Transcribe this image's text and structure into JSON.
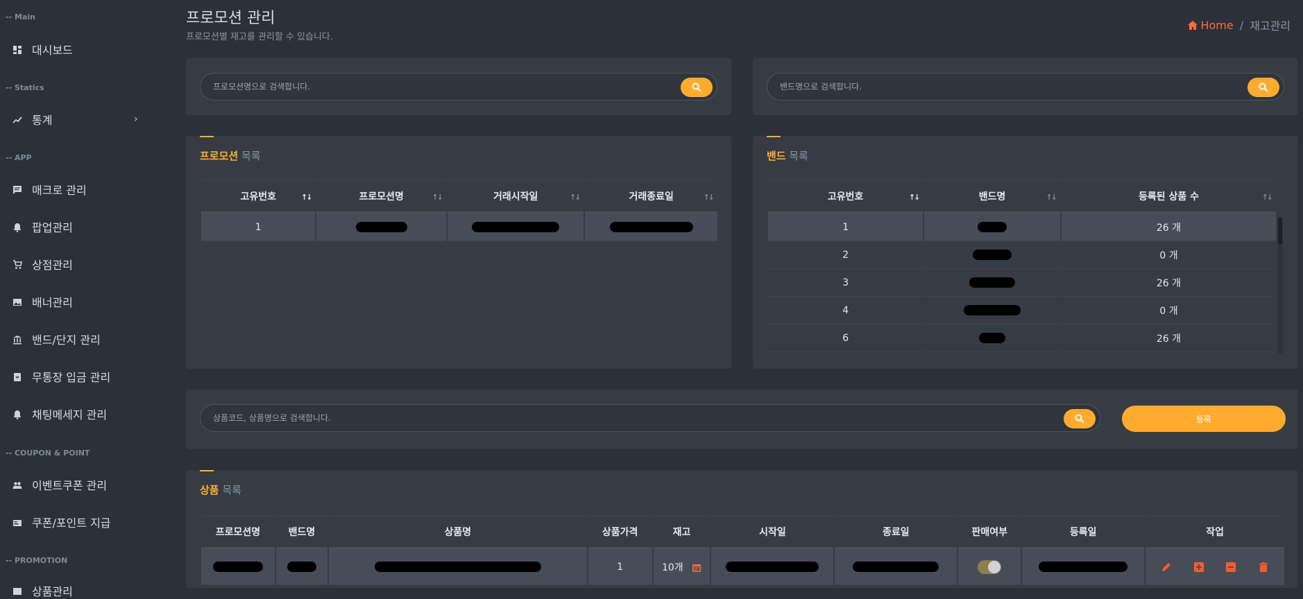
{
  "sidebar": {
    "sections": {
      "main": "-- Main",
      "statics": "-- Statics",
      "app": "-- APP",
      "coupon": "-- COUPON & POINT",
      "promotion": "-- PROMOTION"
    },
    "items": {
      "dashboard": "대시보드",
      "stats": "통계",
      "macro": "매크로 관리",
      "popup": "팝업관리",
      "shop": "상점관리",
      "banner": "배너관리",
      "band": "밴드/단지 관리",
      "deposit": "무통장 입금 관리",
      "chat": "채팅메세지 관리",
      "event_coupon": "이벤트쿠폰 관리",
      "coupon_point": "쿠폰/포인트 지급",
      "promo_partial": "상품관리"
    },
    "icons": {
      "dashboard": "dashboard-icon",
      "stats": "trending-up-icon",
      "macro": "message-icon",
      "popup": "bell-icon",
      "shop": "cart-icon",
      "banner": "image-icon",
      "band": "bank-icon",
      "deposit": "archive-icon",
      "chat": "bell-icon",
      "event_coupon": "people-icon",
      "coupon_point": "card-icon"
    }
  },
  "header": {
    "title": "프로모션 관리",
    "subtitle": "프로모션별 재고를 관리할 수 있습니다.",
    "breadcrumb_home": "Home",
    "breadcrumb_sep": "/",
    "breadcrumb_current": "재고관리"
  },
  "search": {
    "promotion_placeholder": "프로모션명으로 검색합니다.",
    "band_placeholder": "밴드명으로 검색합니다.",
    "product_placeholder": "상품코드, 상품명으로 검색합니다.",
    "register_label": "등록"
  },
  "promotion_list": {
    "title_highlight": "프로모션",
    "title_rest": " 목록",
    "columns": [
      "고유번호",
      "프로모션명",
      "거래시작일",
      "거래종료일"
    ],
    "rows": [
      {
        "id": "1"
      }
    ]
  },
  "band_list": {
    "title_highlight": "밴드",
    "title_rest": " 목록",
    "columns": [
      "고유번호",
      "밴드명",
      "등록된 상품 수"
    ],
    "rows": [
      {
        "id": "1",
        "count": "26 개"
      },
      {
        "id": "2",
        "count": "0 개"
      },
      {
        "id": "3",
        "count": "26 개"
      },
      {
        "id": "4",
        "count": "0 개"
      },
      {
        "id": "6",
        "count": "26 개"
      }
    ]
  },
  "product_list": {
    "title_highlight": "상품",
    "title_rest": " 목록",
    "columns": [
      "프로모션명",
      "밴드명",
      "상품명",
      "상품가격",
      "재고",
      "시작일",
      "종료일",
      "판매여부",
      "등록일",
      "작업"
    ],
    "rows": [
      {
        "price": "1",
        "stock": "10개",
        "on_sale": true
      }
    ]
  },
  "colors": {
    "accent": "#ffb02e",
    "home_link": "#ff6a3d",
    "background": "#2c3038",
    "card": "#363b44"
  }
}
